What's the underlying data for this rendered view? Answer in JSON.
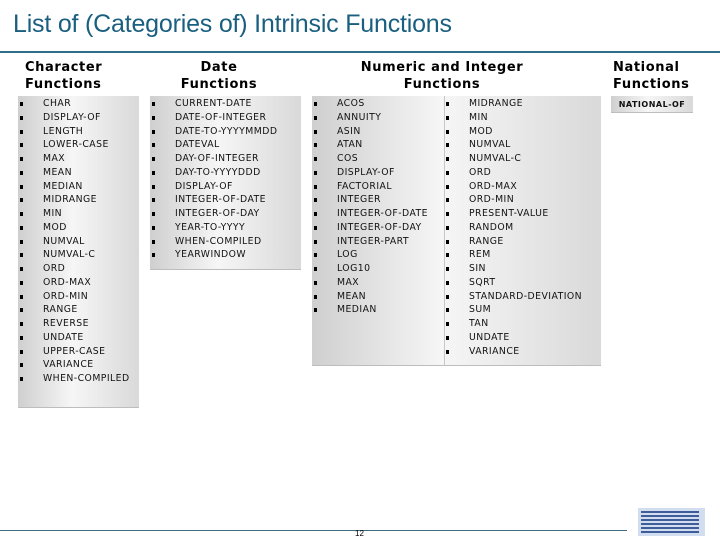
{
  "page": {
    "title": "List of (Categories of) Intrinsic Functions",
    "page_number": "12",
    "logo": "IBM"
  },
  "columns": {
    "character": {
      "heading_line1": "Character",
      "heading_line2": "Functions",
      "items": [
        "CHAR",
        "DISPLAY-OF",
        "LENGTH",
        "LOWER-CASE",
        "MAX",
        "MEAN",
        "MEDIAN",
        "MIDRANGE",
        "MIN",
        "MOD",
        "NUMVAL",
        "NUMVAL-C",
        "ORD",
        "ORD-MAX",
        "ORD-MIN",
        "RANGE",
        "REVERSE",
        "UNDATE",
        "UPPER-CASE",
        "VARIANCE",
        "WHEN-COMPILED"
      ]
    },
    "date": {
      "heading_line1": "Date",
      "heading_line2": "Functions",
      "items": [
        "CURRENT-DATE",
        "DATE-OF-INTEGER",
        "DATE-TO-YYYYMMDD",
        "DATEVAL",
        "DAY-OF-INTEGER",
        "DAY-TO-YYYYDDD",
        "DISPLAY-OF",
        "INTEGER-OF-DATE",
        "INTEGER-OF-DAY",
        "YEAR-TO-YYYY",
        "WHEN-COMPILED",
        "YEARWINDOW"
      ]
    },
    "numeric": {
      "heading_line1": "Numeric and Integer",
      "heading_line2": "Functions",
      "items_left": [
        "ACOS",
        "ANNUITY",
        "ASIN",
        "ATAN",
        "COS",
        "DISPLAY-OF",
        "FACTORIAL",
        "INTEGER",
        "INTEGER-OF-DATE",
        "INTEGER-OF-DAY",
        "INTEGER-PART",
        "LOG",
        "LOG10",
        "MAX",
        "MEAN",
        "MEDIAN"
      ],
      "items_right": [
        "MIDRANGE",
        "MIN",
        "MOD",
        "NUMVAL",
        "NUMVAL-C",
        "ORD",
        "ORD-MAX",
        "ORD-MIN",
        "PRESENT-VALUE",
        "RANDOM",
        "RANGE",
        "REM",
        "SIN",
        "SQRT",
        "STANDARD-DEVIATION",
        "SUM",
        "TAN",
        "UNDATE",
        "VARIANCE"
      ]
    },
    "national": {
      "heading_line1": "National",
      "heading_line2": "Functions",
      "items": [
        "NATIONAL-OF"
      ]
    }
  }
}
